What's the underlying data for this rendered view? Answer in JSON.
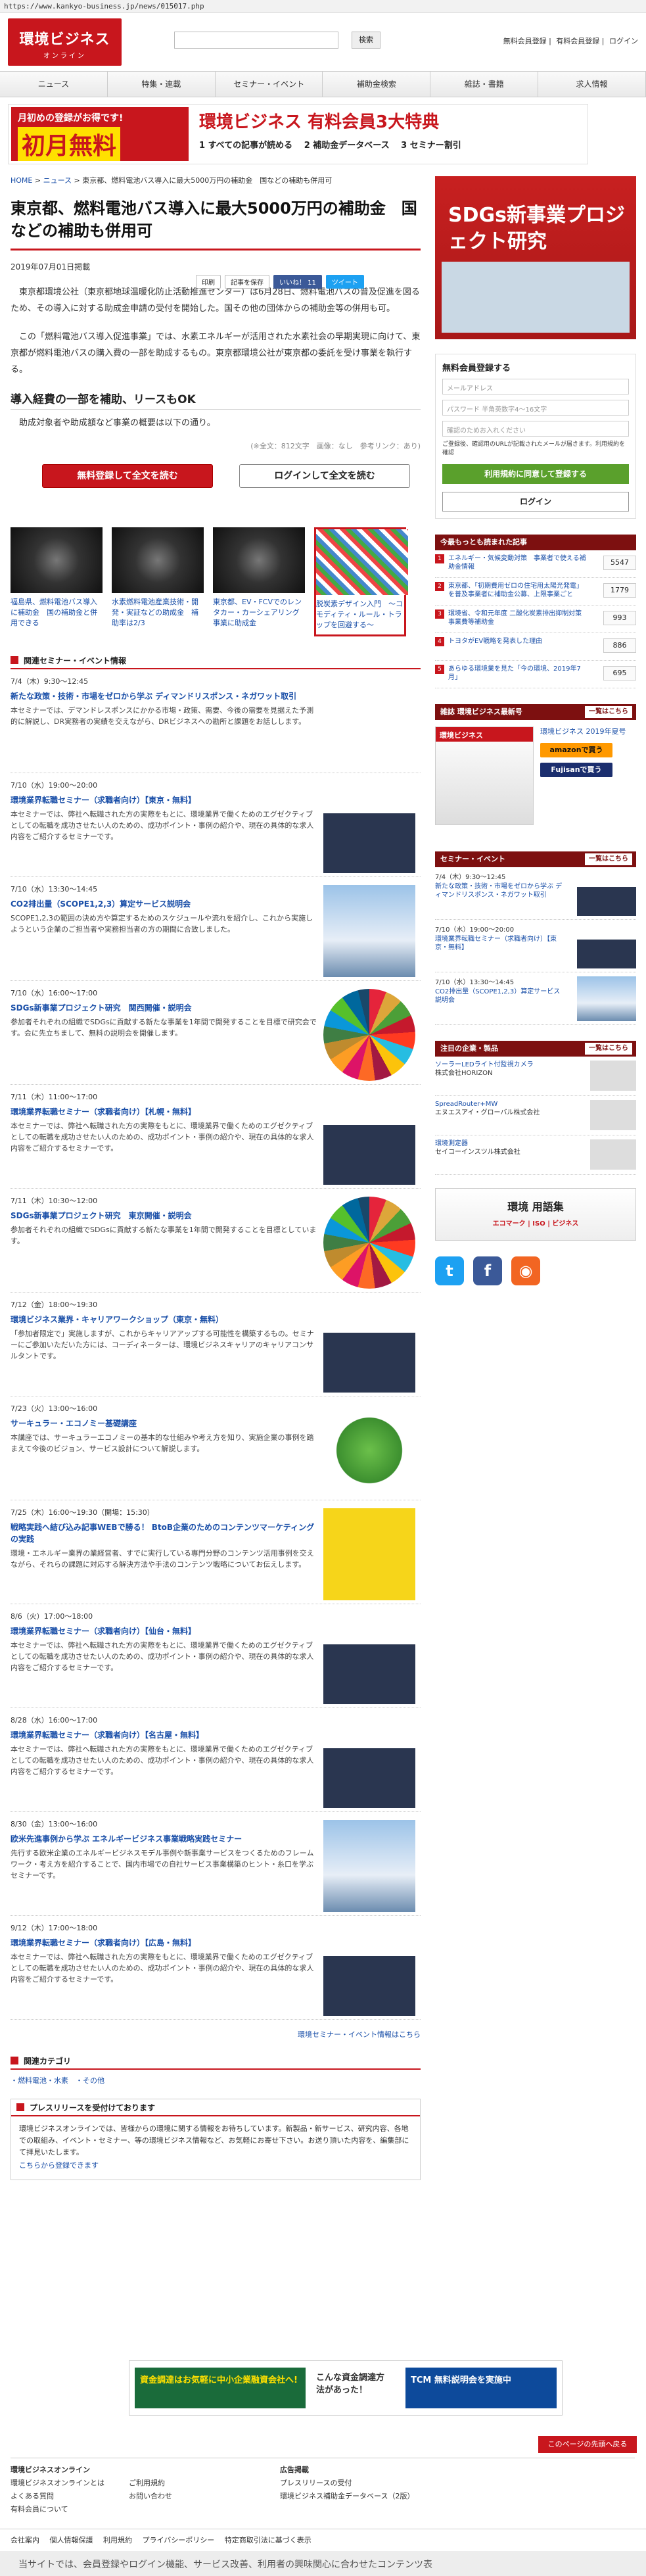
{
  "url": "https://www.kankyo-business.jp/news/015017.php",
  "header": {
    "logo_main": "環境ビジネス",
    "logo_sub": "オンライン",
    "search_button": "検索",
    "links": [
      "無料会員登録",
      "有料会員登録",
      "ログイン"
    ]
  },
  "gnav": [
    "ニュース",
    "特集・連載",
    "セミナー・イベント",
    "補助金検索",
    "雑誌・書籍",
    "求人情報"
  ],
  "banner": {
    "tag": "月初めの登録がお得です!",
    "big": "初月無料",
    "headline": "環境ビジネス 有料会員3大特典",
    "points": [
      "1 すべての記事が読める",
      "2 補助金データベース",
      "3 セミナー割引"
    ]
  },
  "breadcrumb": [
    "HOME",
    "ニュース",
    "東京都、燃料電池バス導入に最大5000万円の補助金　国などの補助も併用可"
  ],
  "article": {
    "title": "東京都、燃料電池バス導入に最大5000万円の補助金　国などの補助も併用可",
    "date": "2019年07月01日掲載",
    "actions": [
      "印刷",
      "記事を保存",
      "いいね！ 11",
      "ツイート"
    ],
    "p1": "東京都環境公社（東京都地球温暖化防止活動推進センター）は6月28日、燃料電池バスの普及促進を図るため、その導入に対する助成金申請の受付を開始した。国その他の団体からの補助金等の併用も可。",
    "p2": "この「燃料電池バス導入促進事業」では、水素エネルギーが活用された水素社会の早期実現に向けて、東京都が燃料電池バスの購入費の一部を助成するもの。東京都環境公社が東京都の委託を受け事業を執行する。",
    "subhead": "導入経費の一部を補助、リースもOK",
    "p3": "助成対象者や助成額など事業の概要は以下の通り。",
    "meta": "(※全文：812文字　画像：なし　参考リンク：あり)",
    "cta_register": "無料登録して全文を読む",
    "cta_login": "ログインして全文を読む"
  },
  "related": [
    "福島県、燃料電池バス導入に補助金　国の補助金と併用できる",
    "水素燃料電池産業技術・開発・実証などの助成金　補助率は2/3",
    "東京都、EV・FCVでのレンタカー・カーシェアリング事業に助成金",
    "脱炭素デザイン入門　〜コモディティ・ルール・トラップを回避する〜"
  ],
  "events_head": "関連セミナー・イベント情報",
  "events": [
    {
      "date": "7/4（木）9:30〜12:45",
      "title": "新たな政策・技術・市場をゼロから学ぶ ディマンドリスポンス・ネガワット取引",
      "text": "本セミナーでは、デマンドレスポンスにかかる市場・政策、需要、今後の需要を見据えた予測的に解説し、DR実務者の実績を交えながら、DRビジネスへの勘所と課題をお話しします。",
      "img": "none"
    },
    {
      "date": "7/10（水）19:00〜20:00",
      "title": "環境業界転職セミナー（求職者向け）【東京・無料】",
      "text": "本セミナーでは、弊社へ転職された方の実際をもとに、環境業界で働くためのエグゼクティブとしての転職を成功させたい人のための、成功ポイント・事例の紹介や、現在の具体的な求人内容をご紹介するセミナーです。",
      "img": "crowd"
    },
    {
      "date": "7/10（水）13:30〜14:45",
      "title": "CO2排出量（SCOPE1,2,3）算定サービス説明会",
      "text": "SCOPE1,2,3の範囲の決め方や算定するためのスケジュールや流れを紹介し、これから実施しようという企業のご担当者や実務担当者の方の期間に合致しました。",
      "img": "city"
    },
    {
      "date": "7/10（水）16:00〜17:00",
      "title": "SDGs新事業プロジェクト研究　関西開催・説明会",
      "text": "参加者それぞれの組織でSDGsに貢献する新たな事業を1年間で開発することを目標で研究会です。会に先立ちまして、無料の説明会を開催します。",
      "img": "sdg"
    },
    {
      "date": "7/11（木）11:00〜17:00",
      "title": "環境業界転職セミナー（求職者向け）【札幌・無料】",
      "text": "本セミナーでは、弊社へ転職された方の実際をもとに、環境業界で働くためのエグゼクティブとしての転職を成功させたい人のための、成功ポイント・事例の紹介や、現在の具体的な求人内容をご紹介するセミナーです。",
      "img": "crowd"
    },
    {
      "date": "7/11（木）10:30〜12:00",
      "title": "SDGs新事業プロジェクト研究　東京開催・説明会",
      "text": "参加者それぞれの組織でSDGsに貢献する新たな事業を1年間で開発することを目標としています。",
      "img": "sdg"
    },
    {
      "date": "7/12（金）18:00〜19:30",
      "title": "環境ビジネス業界・キャリアワークショップ（東京・無料）",
      "text": "「参加者限定で」実施しますが、これからキャリアアップする可能性を構築するもの。セミナーにご参加いただいた方には、コーディネーターは、環境ビジネスキャリアのキャリアコンサルタントです。",
      "img": "crowd"
    },
    {
      "date": "7/23（火）13:00〜16:00",
      "title": "サーキュラー・エコノミー基礎講座",
      "text": "本講座では、サーキュラーエコノミーの基本的な仕組みや考え方を知り、実施企業の事例を踏まえて今後のビジョン、サービス設計について解説します。",
      "img": "eco"
    },
    {
      "date": "7/25（木）16:00〜19:30（開場：15:30）",
      "title": "戦略実践へ結び込み記事WEBで勝る！ BtoB企業のためのコンテンツマーケティングの実践",
      "text": "環境・エネルギー業界の業経営者、すでに実行している専門分野のコンテンツ活用事例を交えながら、それらの課題に対応する解決方法や手法のコンテンツ戦略についてお伝えします。",
      "img": "yel"
    },
    {
      "date": "8/6（火）17:00〜18:00",
      "title": "環境業界転職セミナー（求職者向け）【仙台・無料】",
      "text": "本セミナーでは、弊社へ転職された方の実際をもとに、環境業界で働くためのエグゼクティブとしての転職を成功させたい人のための、成功ポイント・事例の紹介や、現在の具体的な求人内容をご紹介するセミナーです。",
      "img": "crowd"
    },
    {
      "date": "8/28（水）16:00〜17:00",
      "title": "環境業界転職セミナー（求職者向け）【名古屋・無料】",
      "text": "本セミナーでは、弊社へ転職された方の実際をもとに、環境業界で働くためのエグゼクティブとしての転職を成功させたい人のための、成功ポイント・事例の紹介や、現在の具体的な求人内容をご紹介するセミナーです。",
      "img": "crowd"
    },
    {
      "date": "8/30（金）13:00〜16:00",
      "title": "欧米先進事例から学ぶ エネルギービジネス事業戦略実践セミナー",
      "text": "先行する欧米企業のエネルギービジネスモデル事例や新事業サービスをつくるためのフレームワーク・考え方を紹介することで、国内市場での自社サービス事業構築のヒント・糸口を学ぶセミナーです。",
      "img": "city"
    },
    {
      "date": "9/12（木）17:00〜18:00",
      "title": "環境業界転職セミナー（求職者向け）【広島・無料】",
      "text": "本セミナーでは、弊社へ転職された方の実際をもとに、環境業界で働くためのエグゼクティブとしての転職を成功させたい人のための、成功ポイント・事例の紹介や、現在の具体的な求人内容をご紹介するセミナーです。",
      "img": "crowd"
    }
  ],
  "events_more": "環境セミナー・イベント情報はこちら",
  "category_head": "関連カテゴリ",
  "categories": [
    "燃料電池・水素",
    "その他"
  ],
  "pr_head": "プレスリリースを受付けております",
  "pr_text": "環境ビジネスオンラインでは、皆様からの環境に関する情報をお待ちしています。新製品・新サービス、研究内容、各地での取組み、イベント・セミナー、等の環境ビジネス情報など、お気軽にお寄せ下さい。お送り頂いた内容を、編集部にて拝見いたします。",
  "pr_link": "こちらから登録できます",
  "ad_wide": {
    "left": "資金調達はお気軽に中小企業融資会社へ!",
    "mid": "こんな資金調達方法があった！",
    "right": "TCM 無料説明会を実施中"
  },
  "pagetop": "このページの先頭へ戻る",
  "footer": {
    "col1_head": "環境ビジネスオンライン",
    "col1": [
      "環境ビジネスオンラインとは",
      "ご利用規約",
      "よくある質問",
      "有料会員について",
      "お問い合わせ"
    ],
    "col2_head": "広告掲載",
    "col2": [
      "プレスリリースの受付",
      "環境ビジネス補助金データベース（2版）"
    ],
    "bar": [
      "会社案内",
      "個人情報保護",
      "利用規約",
      "プライバシーポリシー",
      "特定商取引法に基づく表示"
    ]
  },
  "cookie": "当サイトでは、会員登録やログイン機能、サービス改善、利用者の興味関心に合わせたコンテンツ表",
  "sidebar": {
    "ad_text": "SDGs新事業プロジェクト研究",
    "reg_head": "無料会員登録する",
    "email_ph": "メールアドレス",
    "pass_ph": "パスワード 半角英数字4〜16文字",
    "pass2_ph": "確認のためお入れください",
    "note": "ご登録後、確認用のURLが記載されたメールが届きます。利用規約を確認",
    "agree": "利用規約に同意して登録する",
    "login": "ログイン",
    "rank_head": "今最もっとも読まれた記事",
    "ranking": [
      {
        "t": "エネルギー・気候変動対策　事業者で使える補助金情報",
        "c": "5547"
      },
      {
        "t": "東京都、「初期費用ゼロの住宅用太陽光発電」を普及事業者に補助金公募、上限事業ごと",
        "c": "1779"
      },
      {
        "t": "環境省、令和元年度 二酸化炭素排出抑制対策事業費等補助金",
        "c": "993"
      },
      {
        "t": "トヨタがEV戦略を発表した理由",
        "c": "886"
      },
      {
        "t": "あらゆる環境業を見た「今の環境、2019年7月」",
        "c": "695"
      }
    ],
    "mag_head": "雑誌 環境ビジネス最新号",
    "mag_more": "一覧はこちら",
    "mag_cover": "環境ビジネス",
    "mag_title": "環境ビジネス 2019年夏号",
    "amazon": "amazonで買う",
    "fujisan": "Fujisanで買う",
    "ev_head": "セミナー・イベント",
    "ev_more": "一覧はこちら",
    "sb_events": [
      {
        "d": "7/4（木）9:30〜12:45",
        "t": "新たな政策・技術・市場をゼロから学ぶ ディマンドリスポンス・ネガワット取引"
      },
      {
        "d": "7/10（水）19:00〜20:00",
        "t": "環境業界転職セミナー（求職者向け）【東京・無料】"
      },
      {
        "d": "7/10（水）13:30〜14:45",
        "t": "CO2排出量（SCOPE1,2,3）算定サービス説明会"
      }
    ],
    "prod_head": "注目の企業・製品",
    "prod_more": "一覧はこちら",
    "products": [
      {
        "t": "ソーラーLEDライト付監視カメラ",
        "c": "株式会社HORIZON"
      },
      {
        "t": "SpreadRouter+MW",
        "c": "エヌエスアイ・グローバル株式会社"
      },
      {
        "t": "環境測定器",
        "c": "セイコーインスツル株式会社"
      }
    ],
    "env_title": "環境 用語集",
    "env_sub": "エコマーク | ISO | ビジネス"
  }
}
